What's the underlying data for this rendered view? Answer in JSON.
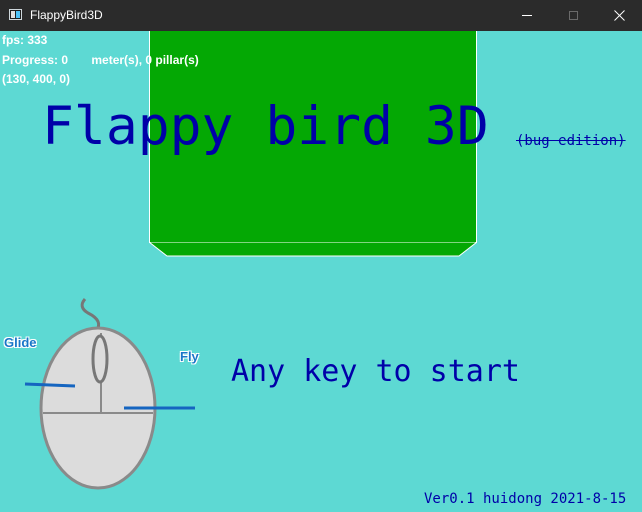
{
  "window": {
    "title": "FlappyBird3D",
    "icon": "app-window-icon",
    "controls": [
      "minimize-icon",
      "maximize-icon",
      "close-icon"
    ]
  },
  "hud": {
    "fps": "fps: 333",
    "progress": "Progress: 0       meter(s), 0 pillar(s)",
    "position": "(130, 400, 0)"
  },
  "title": {
    "main": "Flappy bird 3D",
    "subtitle": "(bug edition)"
  },
  "controls_hint": {
    "glide": "Glide",
    "fly": "Fly",
    "icon": "mouse-icon"
  },
  "prompt": "Any key to start",
  "version": "Ver0.1 huidong 2021-8-15",
  "colors": {
    "background": "#5dd9d3",
    "pillar": "#04a804",
    "text": "#0000a8",
    "hud": "#ffffff",
    "hint": "#1976c8",
    "titlebar": "#2b2b2b"
  }
}
